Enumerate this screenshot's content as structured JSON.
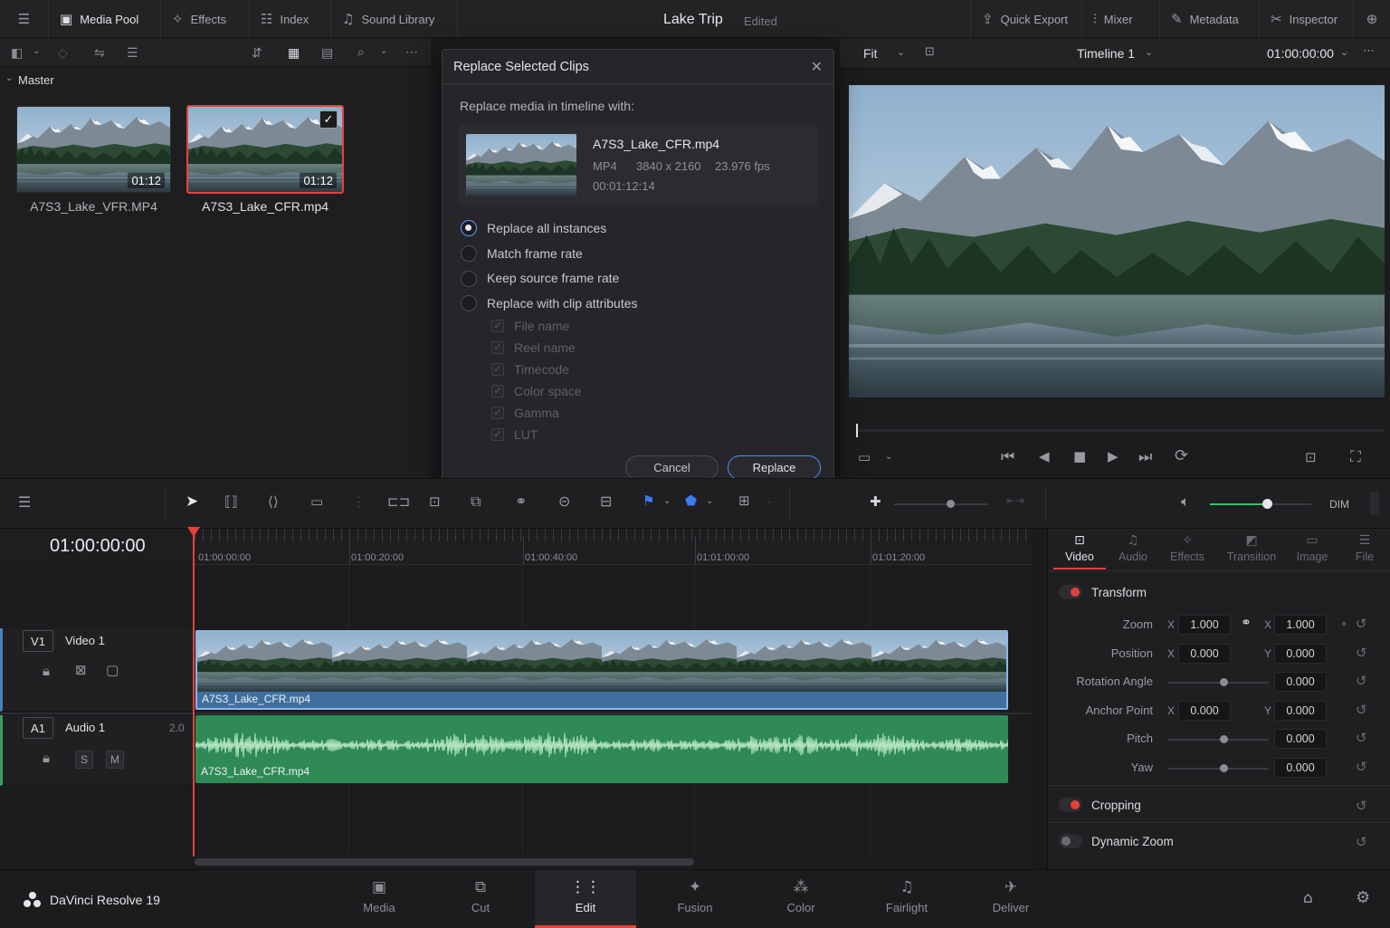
{
  "topbar": {
    "left_items": [
      {
        "label": "Media Pool",
        "icon": "media-pool-icon"
      },
      {
        "label": "Effects",
        "icon": "effects-icon"
      },
      {
        "label": "Index",
        "icon": "index-icon"
      },
      {
        "label": "Sound Library",
        "icon": "sound-library-icon"
      }
    ],
    "title": "Lake Trip",
    "status": "Edited",
    "right_items": [
      {
        "label": "Quick Export",
        "icon": "export-icon"
      },
      {
        "label": "Mixer",
        "icon": "mixer-icon"
      },
      {
        "label": "Metadata",
        "icon": "metadata-icon"
      },
      {
        "label": "Inspector",
        "icon": "inspector-icon"
      }
    ]
  },
  "media_pool": {
    "folder": "Master",
    "clips": [
      {
        "name": "A7S3_Lake_VFR.MP4",
        "duration": "01:12",
        "selected": false
      },
      {
        "name": "A7S3_Lake_CFR.mp4",
        "duration": "01:12",
        "selected": true
      }
    ]
  },
  "dialog": {
    "title": "Replace Selected Clips",
    "prompt": "Replace media in timeline with:",
    "clip": {
      "name": "A7S3_Lake_CFR.mp4",
      "format": "MP4",
      "resolution": "3840 x 2160",
      "fps": "23.976 fps",
      "duration": "00:01:12:14"
    },
    "options": [
      {
        "label": "Replace all instances",
        "selected": true
      },
      {
        "label": "Match frame rate",
        "selected": false
      },
      {
        "label": "Keep source frame rate",
        "selected": false
      },
      {
        "label": "Replace with clip attributes",
        "selected": false
      }
    ],
    "attributes": [
      "File name",
      "Reel name",
      "Timecode",
      "Color space",
      "Gamma",
      "LUT"
    ],
    "cancel_label": "Cancel",
    "replace_label": "Replace"
  },
  "viewer": {
    "zoom": "Fit",
    "timeline_name": "Timeline 1",
    "timecode": "01:00:00:00"
  },
  "timeline_toolbar": {
    "dim_label": "DIM"
  },
  "timeline": {
    "current_timecode": "01:00:00:00",
    "ruler_ticks": [
      "01:00:00:00",
      "01:00:20:00",
      "01:00:40:00",
      "01:01:00:00",
      "01:01:20:00"
    ],
    "tracks": {
      "video": {
        "id": "V1",
        "name": "Video 1",
        "clip": "A7S3_Lake_CFR.mp4"
      },
      "audio": {
        "id": "A1",
        "name": "Audio 1",
        "level": "2.0",
        "clip": "A7S3_Lake_CFR.mp4",
        "solo_label": "S",
        "mute_label": "M"
      }
    }
  },
  "inspector": {
    "tabs": [
      {
        "label": "Video",
        "icon": "video-tab-icon",
        "active": true
      },
      {
        "label": "Audio",
        "icon": "audio-tab-icon",
        "active": false
      },
      {
        "label": "Effects",
        "icon": "effects-tab-icon",
        "active": false
      },
      {
        "label": "Transition",
        "icon": "transition-tab-icon",
        "active": false
      },
      {
        "label": "Image",
        "icon": "image-tab-icon",
        "active": false
      },
      {
        "label": "File",
        "icon": "file-tab-icon",
        "active": false
      }
    ],
    "transform_label": "Transform",
    "zoom": {
      "label": "Zoom",
      "x_axis": "X",
      "x": "1.000",
      "y_axis": "X",
      "y": "1.000"
    },
    "position": {
      "label": "Position",
      "x_axis": "X",
      "x": "0.000",
      "y_axis": "Y",
      "y": "0.000"
    },
    "rotation": {
      "label": "Rotation Angle",
      "value": "0.000"
    },
    "anchor": {
      "label": "Anchor Point",
      "x_axis": "X",
      "x": "0.000",
      "y_axis": "Y",
      "y": "0.000"
    },
    "pitch": {
      "label": "Pitch",
      "value": "0.000"
    },
    "yaw": {
      "label": "Yaw",
      "value": "0.000"
    },
    "cropping_label": "Cropping",
    "dynamic_zoom_label": "Dynamic Zoom"
  },
  "pages": {
    "app_name": "DaVinci Resolve 19",
    "items": [
      {
        "label": "Media",
        "icon": "media-page-icon",
        "active": false
      },
      {
        "label": "Cut",
        "icon": "cut-page-icon",
        "active": false
      },
      {
        "label": "Edit",
        "icon": "edit-page-icon",
        "active": true
      },
      {
        "label": "Fusion",
        "icon": "fusion-page-icon",
        "active": false
      },
      {
        "label": "Color",
        "icon": "color-page-icon",
        "active": false
      },
      {
        "label": "Fairlight",
        "icon": "fairlight-page-icon",
        "active": false
      },
      {
        "label": "Deliver",
        "icon": "deliver-page-icon",
        "active": false
      }
    ]
  },
  "colors": {
    "accent_red": "#e5403b",
    "selection_blue": "#5f9bff",
    "video_clip": "#3f6f9f",
    "audio_clip": "#2f8a55"
  }
}
